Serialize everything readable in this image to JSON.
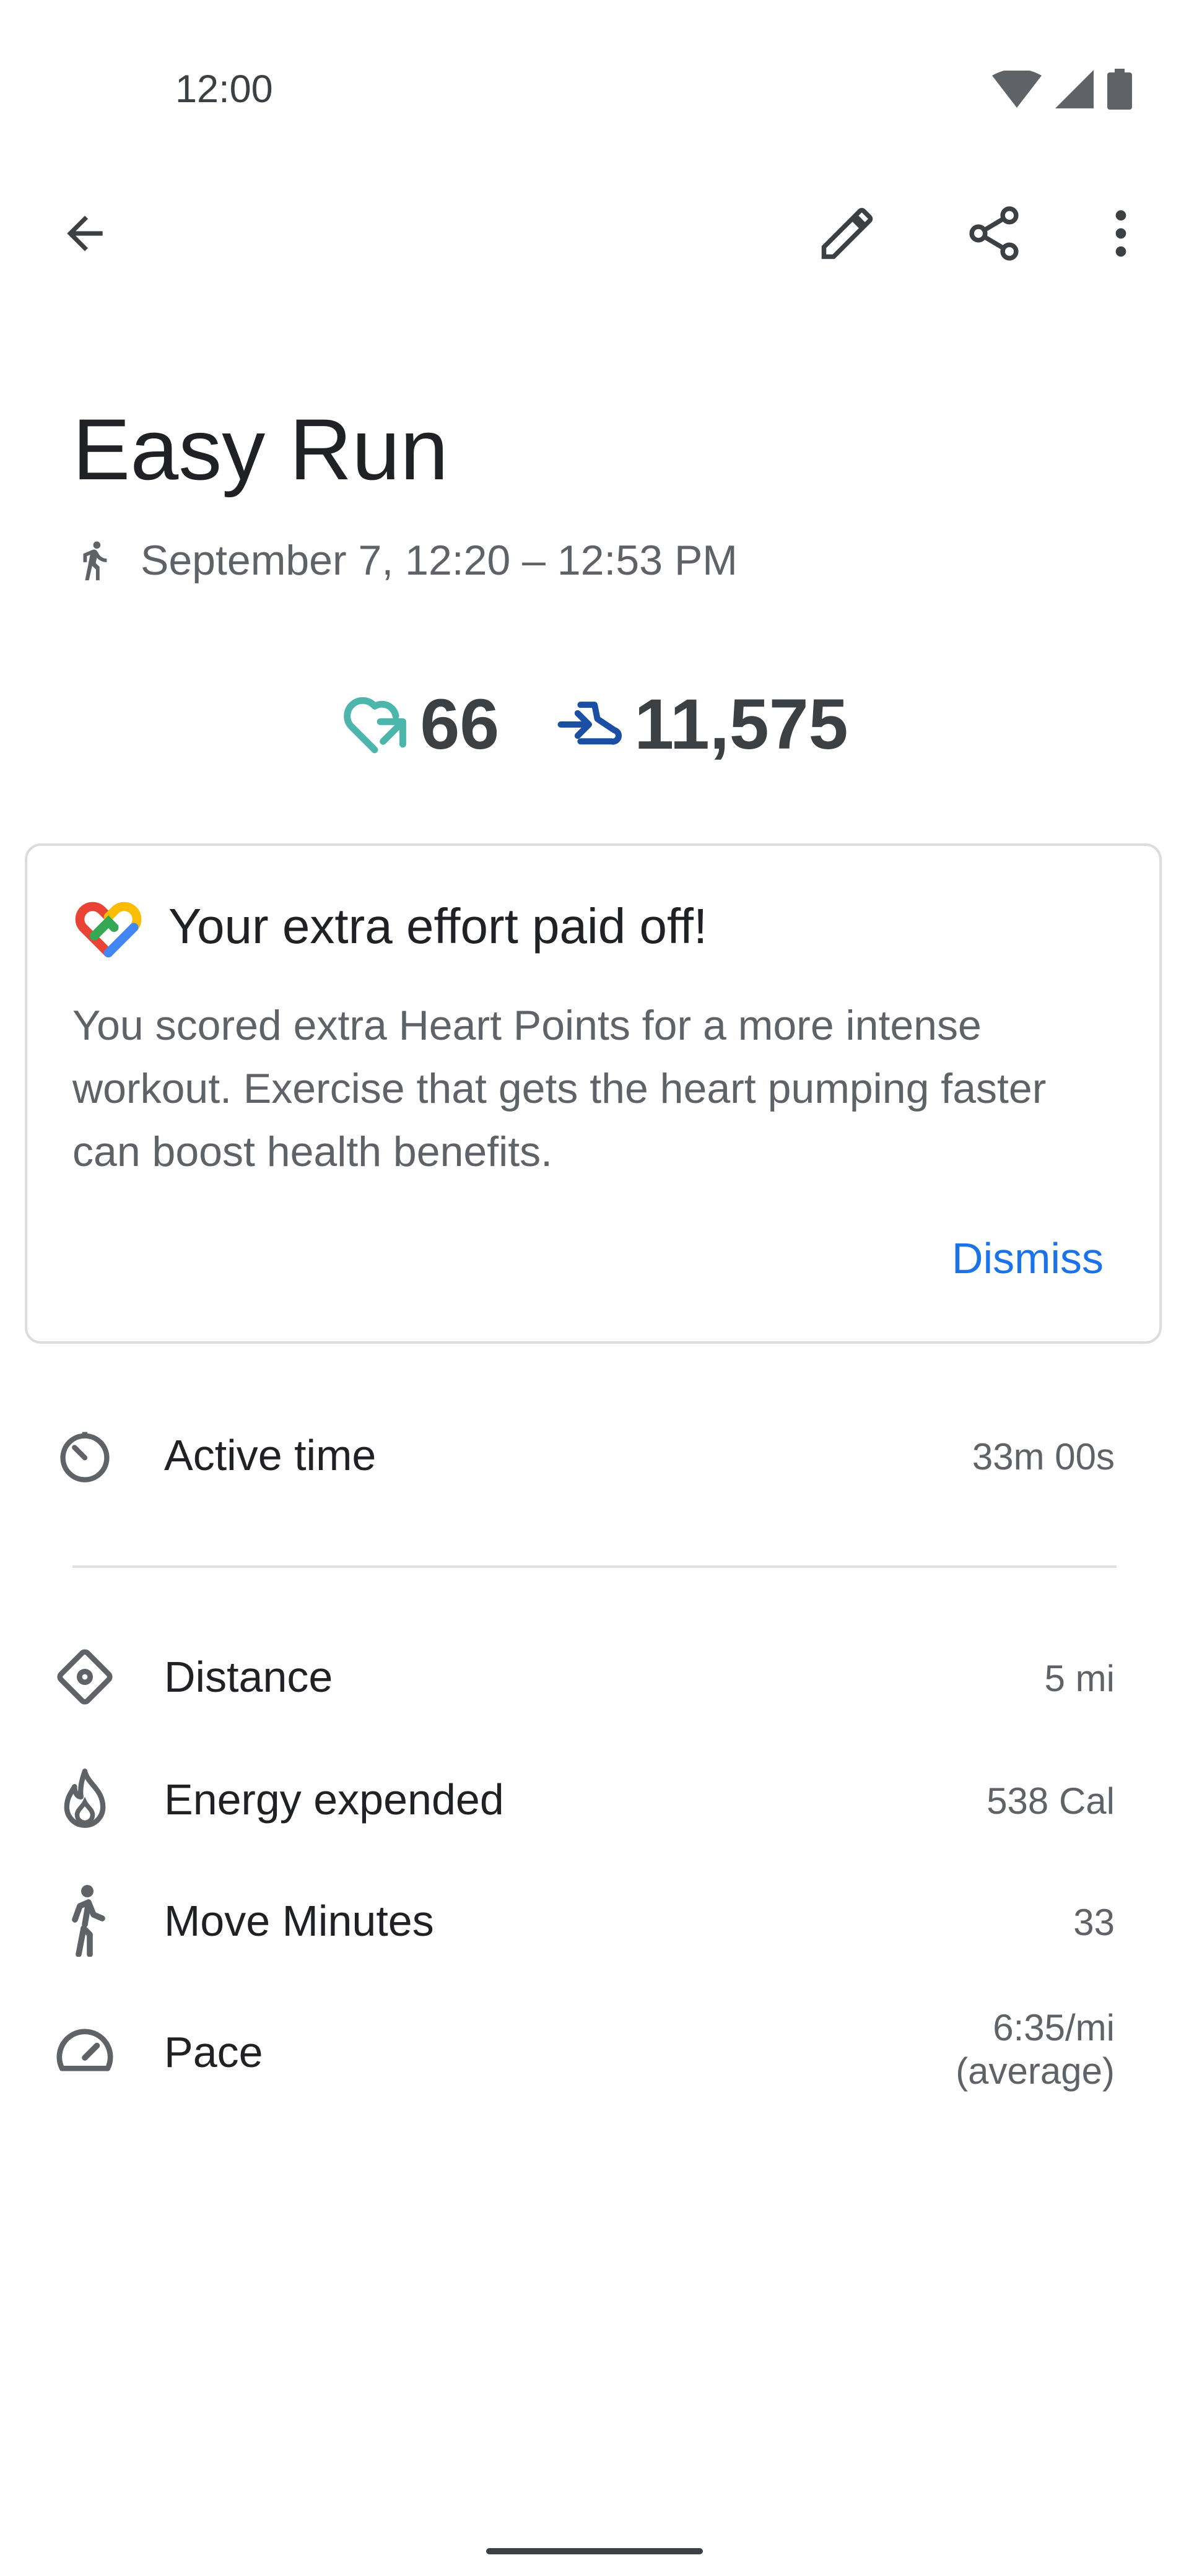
{
  "status_bar": {
    "time": "12:00",
    "icons": [
      "wifi-icon",
      "cellular-icon",
      "battery-icon"
    ]
  },
  "toolbar": {
    "back": "back-arrow-icon",
    "edit": "edit-pencil-icon",
    "share": "share-icon",
    "more": "more-vert-icon"
  },
  "activity": {
    "title": "Easy Run",
    "date_range": "September 7, 12:20 – 12:53 PM",
    "heart_points": "66",
    "steps": "11,575"
  },
  "card": {
    "title": "Your extra effort paid off!",
    "body": "You scored extra Heart Points for a more intense workout. Exercise that gets the heart pumping faster can boost health benefits.",
    "dismiss_label": "Dismiss"
  },
  "stats": [
    {
      "label": "Active time",
      "value": "33m 00s",
      "icon": "timer-icon"
    },
    {
      "label": "Distance",
      "value": "5 mi",
      "icon": "distance-icon"
    },
    {
      "label": "Energy expended",
      "value": "538 Cal",
      "icon": "fire-icon"
    },
    {
      "label": "Move Minutes",
      "value": "33",
      "icon": "walking-icon"
    },
    {
      "label": "Pace",
      "value": "6:35/mi",
      "value_note": "(average)",
      "icon": "speedometer-icon"
    }
  ],
  "colors": {
    "accent": "#1a73e8",
    "heart_points": "#4db6ac",
    "steps": "#1a4fa3",
    "text_primary": "#202124",
    "text_secondary": "#5f6368"
  }
}
